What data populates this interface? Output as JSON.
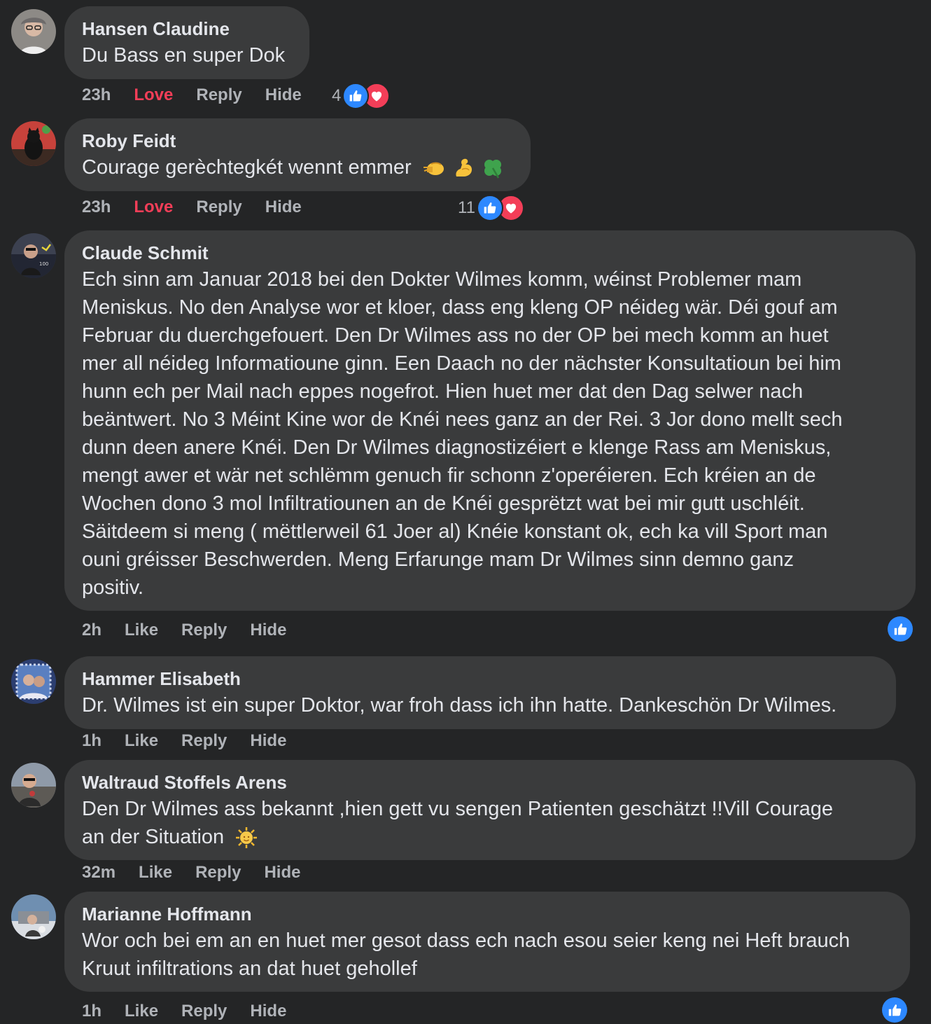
{
  "comments": [
    {
      "author": "Hansen Claudine",
      "text": "Du Bass en super Dok",
      "time": "23h",
      "primary_action": "Love",
      "reply": "Reply",
      "hide": "Hide",
      "reaction_count": "4",
      "reactions": [
        "like-icon",
        "love-icon"
      ]
    },
    {
      "author": "Roby Feidt",
      "text": "Courage gerèchtegkét wennt emmer",
      "emojis": [
        "fist-bump-icon",
        "flexed-biceps-icon",
        "shamrock-icon"
      ],
      "time": "23h",
      "primary_action": "Love",
      "reply": "Reply",
      "hide": "Hide",
      "reaction_count": "11",
      "reactions": [
        "like-icon",
        "love-icon"
      ]
    },
    {
      "author": "Claude Schmit",
      "lines": [
        "Ech sinn am Januar 2018 bei den Dokter Wilmes komm, wéinst Problemer mam",
        "Meniskus. No den Analyse wor et kloer, dass eng kleng OP néideg wär. Déi gouf am",
        "Februar du duerchgefouert. Den Dr Wilmes ass no der OP bei mech komm an huet",
        "mer all néideg Informatioune ginn. Een Daach no der nächster Konsultatioun bei him",
        "hunn ech per Mail nach eppes nogefrot. Hien huet mer dat den Dag selwer nach",
        "beäntwert. No 3 Méint Kine wor de Knéi nees ganz an der Rei. 3 Jor dono mellt sech",
        "dunn deen anere Knéi. Den Dr Wilmes diagnostizéiert e klenge Rass am Meniskus,",
        "mengt awer et wär net schlëmm genuch fir schonn z'operéieren. Ech kréien an de",
        "Wochen dono 3 mol Infiltratiounen an de Knéi gesprëtzt wat bei mir gutt uschléit.",
        "Säitdeem si meng ( mëttlerweil 61 Joer al) Knéie konstant ok, ech ka vill Sport man",
        "ouni gréisser Beschwerden. Meng Erfarunge mam Dr Wilmes sinn demno ganz",
        "positiv."
      ],
      "time": "2h",
      "primary_action": "Like",
      "reply": "Reply",
      "hide": "Hide",
      "reactions": [
        "like-icon"
      ]
    },
    {
      "author": "Hammer Elisabeth",
      "text": "Dr. Wilmes ist ein super Doktor, war froh dass ich ihn hatte. Dankeschön Dr Wilmes.",
      "time": "1h",
      "primary_action": "Like",
      "reply": "Reply",
      "hide": "Hide"
    },
    {
      "author": "Waltraud Stoffels Arens",
      "lines": [
        "Den Dr Wilmes ass bekannt ,hien gett vu sengen Patienten geschätzt !!Vill Courage",
        "an der Situation"
      ],
      "emojis": [
        "sun-with-face-icon"
      ],
      "time": "32m",
      "primary_action": "Like",
      "reply": "Reply",
      "hide": "Hide"
    },
    {
      "author": "Marianne Hoffmann",
      "lines": [
        "Wor och bei em an en huet mer gesot dass ech nach esou seier keng nei Heft brauch",
        "Kruut infiltrations an dat huet gehollef"
      ],
      "time": "1h",
      "primary_action": "Like",
      "reply": "Reply",
      "hide": "Hide",
      "reactions": [
        "like-icon"
      ]
    }
  ],
  "colors": {
    "background": "#242526",
    "bubble": "#3a3b3c",
    "text": "#e4e6eb",
    "muted": "#b0b3b8",
    "love": "#f33e58",
    "like": "#2d88ff"
  }
}
